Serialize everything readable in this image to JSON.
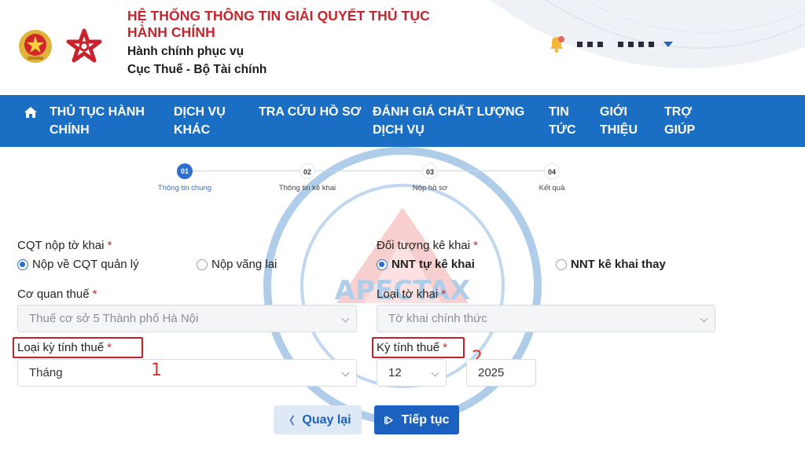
{
  "header": {
    "title_line1": "HỆ THỐNG THÔNG TIN GIẢI QUYẾT THỦ TỤC",
    "title_line2": "HÀNH CHÍNH",
    "subtitle1": "Hành chính phục vụ",
    "subtitle2": "Cục Thuế - Bộ Tài chính"
  },
  "nav": {
    "items": [
      {
        "line1": "THỦ TỤC HÀNH",
        "line2": "CHÍNH"
      },
      {
        "line1": "DỊCH VỤ",
        "line2": "KHÁC"
      },
      {
        "line1": "TRA CỨU HỒ SƠ",
        "line2": ""
      },
      {
        "line1": "ĐÁNH GIÁ CHẤT LƯỢNG",
        "line2": "DỊCH VỤ"
      },
      {
        "line1": "TIN",
        "line2": "TỨC"
      },
      {
        "line1": "GIỚI",
        "line2": "THIỆU"
      },
      {
        "line1": "TRỢ",
        "line2": "GIÚP"
      }
    ]
  },
  "stepper": {
    "steps": [
      {
        "num": "01",
        "label": "Thông tin chung"
      },
      {
        "num": "02",
        "label": "Thông tin kê khai"
      },
      {
        "num": "03",
        "label": "Nộp hồ sơ"
      },
      {
        "num": "04",
        "label": "Kết quả"
      }
    ],
    "active_index": 0
  },
  "watermark": {
    "brand": "APECTAX"
  },
  "form": {
    "cqt_label": "CQT nộp tờ khai",
    "cqt_options": [
      "Nộp về CQT quản lý",
      "Nộp vãng lai"
    ],
    "cqt_selected": "Nộp về CQT quản lý",
    "doituong_label": "Đối tượng kê khai",
    "doituong_options": [
      "NNT tự kê khai",
      "NNT kê khai thay"
    ],
    "doituong_selected": "NNT tự kê khai",
    "coquan_label": "Cơ quan thuế",
    "coquan_value": "Thuế cơ sở 5 Thành phố Hà Nội",
    "loaitokhai_label": "Loại tờ khai",
    "loaitokhai_value": "Tờ khai chính thức",
    "loaiky_label": "Loại kỳ tính thuế",
    "loaiky_value": "Tháng",
    "kytinh_label": "Kỳ tính thuế",
    "kytinh_month": "12",
    "kytinh_year": "2025",
    "required_mark": "*"
  },
  "annotations": {
    "n1": "1",
    "n2": "2"
  },
  "buttons": {
    "back": "Quay lại",
    "next": "Tiếp tục"
  },
  "colors": {
    "nav_bg": "#1a6fc4",
    "title_red": "#c8232c",
    "primary": "#1c61bf",
    "highlight": "#c4202a"
  }
}
